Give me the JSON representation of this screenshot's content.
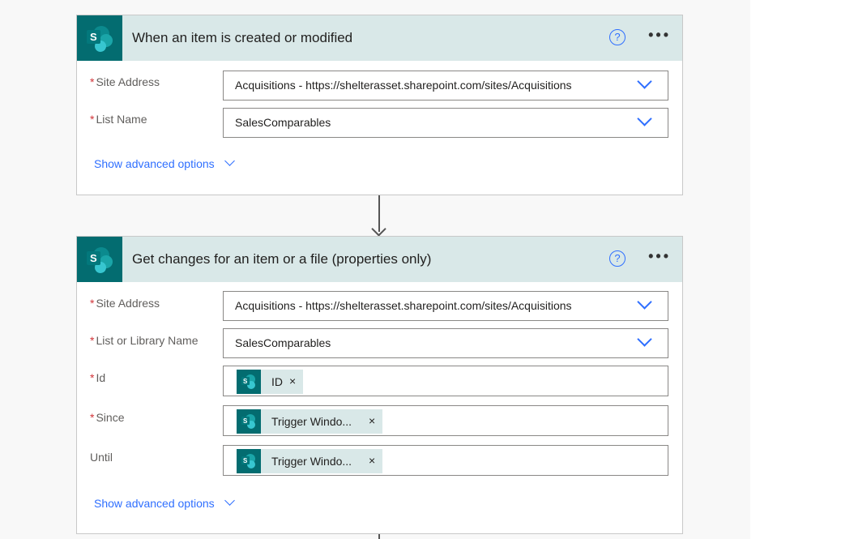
{
  "cards": [
    {
      "title": "When an item is created or modified",
      "fields": [
        {
          "label": "Site Address",
          "required": true,
          "value": "Acquisitions - https://shelterasset.sharepoint.com/sites/Acquisitions"
        },
        {
          "label": "List Name",
          "required": true,
          "value": "SalesComparables"
        }
      ],
      "advanced": "Show advanced options"
    },
    {
      "title": "Get changes for an item or a file (properties only)",
      "fields": [
        {
          "label": "Site Address",
          "required": true,
          "value": "Acquisitions - https://shelterasset.sharepoint.com/sites/Acquisitions"
        },
        {
          "label": "List or Library Name",
          "required": true,
          "value": "SalesComparables"
        },
        {
          "label": "Id",
          "required": true,
          "token": "ID"
        },
        {
          "label": "Since",
          "required": true,
          "token": "Trigger Windo..."
        },
        {
          "label": "Until",
          "required": false,
          "token": "Trigger Windo..."
        }
      ],
      "advanced": "Show advanced options"
    }
  ],
  "icons": {
    "help": "?",
    "more": "•••",
    "remove": "×",
    "required": "*",
    "logo_letter": "S"
  },
  "colors": {
    "accent": "#2f6fff",
    "header_bg": "#d9e8e8",
    "sharepoint": "#036c70",
    "required": "#d13438"
  }
}
